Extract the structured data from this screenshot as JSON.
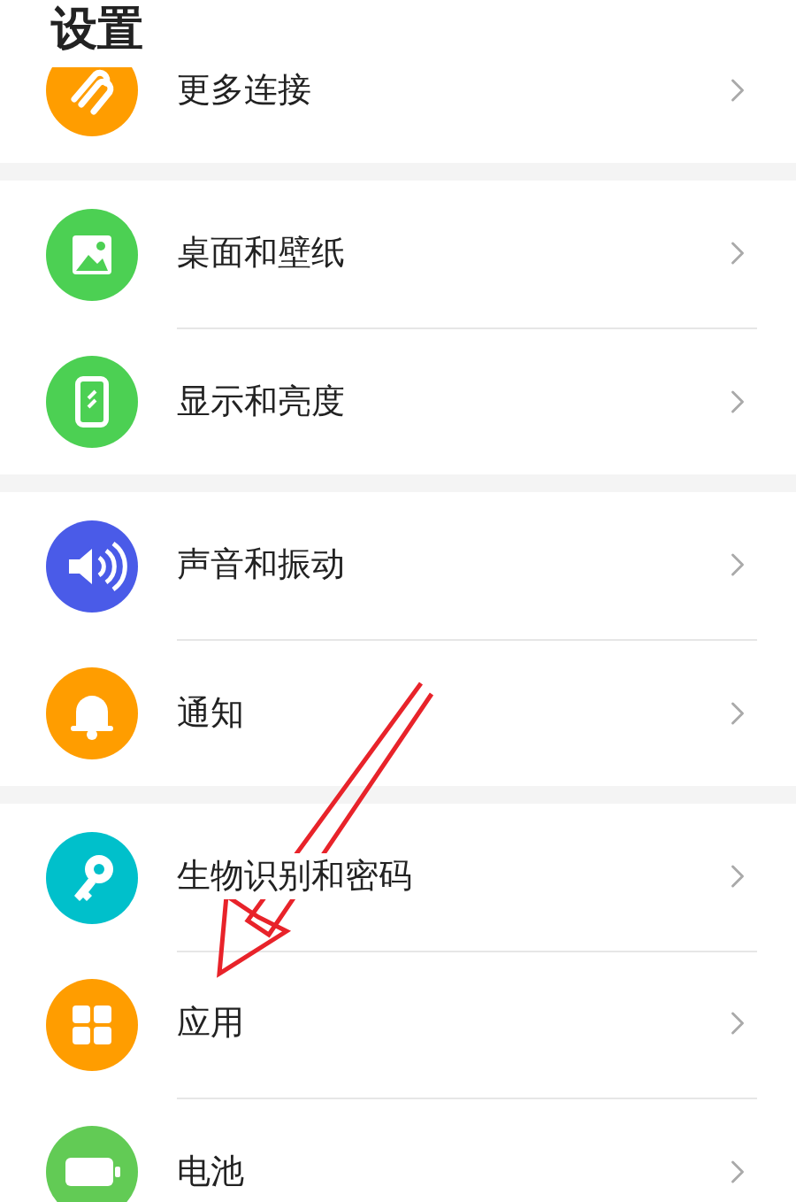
{
  "title": "设置",
  "groups": [
    [
      {
        "label": "更多连接",
        "color": "#ff9d00"
      }
    ],
    [
      {
        "label": "桌面和壁纸",
        "color": "#4cd053"
      },
      {
        "label": "显示和亮度",
        "color": "#4cd053"
      }
    ],
    [
      {
        "label": "声音和振动",
        "color": "#4a5be8"
      },
      {
        "label": "通知",
        "color": "#ff9d00"
      }
    ],
    [
      {
        "label": "生物识别和密码",
        "color": "#00c0cb"
      },
      {
        "label": "应用",
        "color": "#ff9d00"
      },
      {
        "label": "电池",
        "color": "#62cb55"
      }
    ]
  ]
}
